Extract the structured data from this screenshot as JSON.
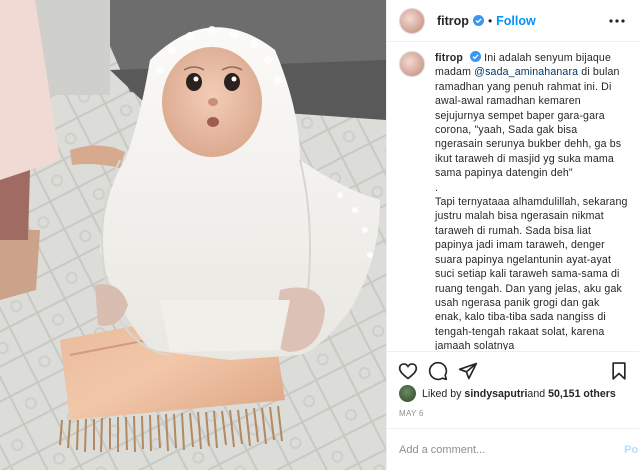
{
  "post": {
    "username": "fitrop",
    "follow_label": "Follow",
    "separator": "•",
    "caption": {
      "username": "fitrop",
      "intro_before_mention": "Ini adalah senyum bijaque madam ",
      "mention": "@sada_aminahanara",
      "intro_after_mention": " di bulan ramadhan yang penuh rahmat ini. Di awal-awal ramadhan kemaren sejujurnya sempet baper gara-gara corona, \"yaah, Sada gak bisa ngerasain serunya bukber dehh, ga bs ikut taraweh di masjid yg suka mama sama papinya datengin deh\"",
      "dot_line": ".",
      "paragraph_2": "Tapi ternyataaa alhamdulillah, sekarang justru malah bisa ngerasain nikmat taraweh di rumah. Sada bisa liat papinya jadi imam taraweh, denger suara papinya ngelantunin ayat-ayat suci setiap kali taraweh sama-sama di ruang tengah. Dan yang jelas, aku gak usah ngerasa panik grogi dan gak enak, kalo tiba-tiba sada nangiss di tengah-tengah rakaat solat, karena jamaah solatnya"
    },
    "likes": {
      "prefix": "Liked by ",
      "first_liker": "sindysaputri",
      "middle": " and ",
      "count": "50,151 others"
    },
    "date": "MAY 6",
    "comment": {
      "placeholder": "Add a comment...",
      "post_label": "Post"
    }
  },
  "icons": [
    "verified-badge-icon",
    "more-options-icon",
    "heart-icon",
    "comment-icon",
    "share-icon",
    "bookmark-icon"
  ],
  "colors": {
    "link_blue": "#0095f6",
    "mention": "#00376b",
    "muted": "#8e8e8e",
    "post_disabled": "#b2dffc"
  }
}
